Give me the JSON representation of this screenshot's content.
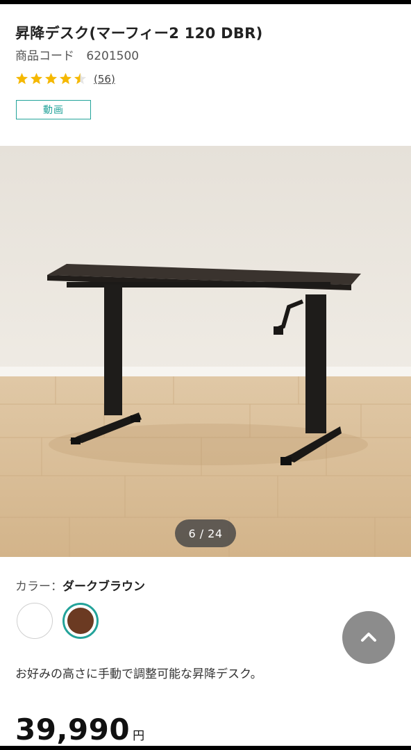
{
  "product": {
    "title": "昇降デスク(マーフィー2 120 DBR)",
    "code_label": "商品コード",
    "code": "6201500",
    "rating": 4.5,
    "review_count": "(56)",
    "video_badge": "動画",
    "description": "お好みの高さに手動で調整可能な昇降デスク。",
    "price": "39,990",
    "currency": "円"
  },
  "gallery": {
    "counter": "6 / 24",
    "current": 6,
    "total": 24
  },
  "color": {
    "label": "カラー：",
    "selected": "ダークブラウン",
    "options": [
      {
        "name": "white",
        "hex": "#ffffff"
      },
      {
        "name": "dark-brown",
        "hex": "#6b3a22"
      }
    ]
  },
  "theme": {
    "accent": "#23a39a",
    "star": "#f5b800"
  },
  "icons": {
    "scroll_top": "chevron-up-icon",
    "star": "star-icon"
  }
}
